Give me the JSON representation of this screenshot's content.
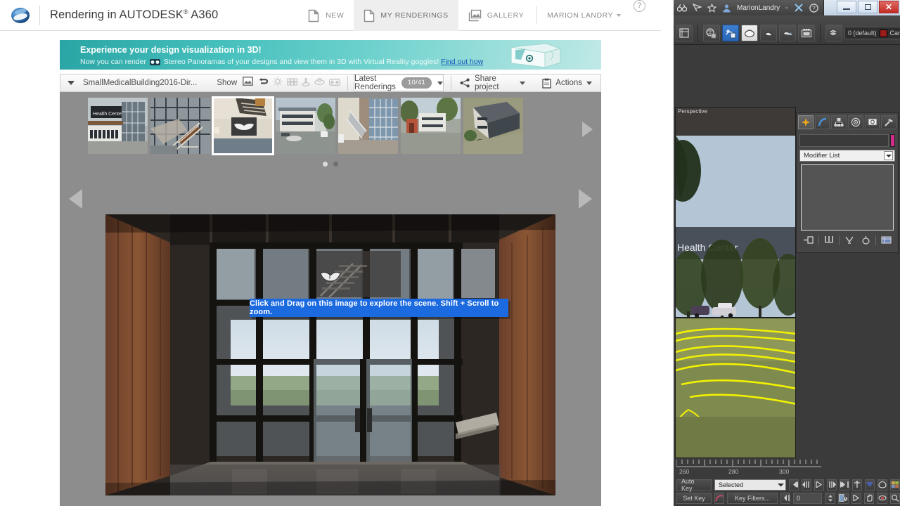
{
  "app": {
    "brand_title": "Rendering in AUTODESK",
    "brand_sup": "®",
    "brand_product": "A360",
    "logo_icon": "autodesk-a360-logo"
  },
  "nav": {
    "items": [
      {
        "label": "NEW",
        "icon": "new-document-icon",
        "active": false
      },
      {
        "label": "MY RENDERINGS",
        "icon": "document-icon",
        "active": true
      },
      {
        "label": "GALLERY",
        "icon": "gallery-image-icon",
        "active": false
      }
    ],
    "user": "MARION LANDRY",
    "user_caret_icon": "chevron-down-icon",
    "help_icon": "help-question-icon",
    "help_label": "?"
  },
  "banner": {
    "headline": "Experience your design visualization in 3D!",
    "body_before": "Now you can render",
    "goggles_icon": "vr-goggles-icon",
    "body_after": "Stereo Panoramas of your designs and view them in 3D with Virtual Reality goggles!",
    "link": "Find out how",
    "hero_icon": "vr-headset-illustration"
  },
  "toolbar": {
    "project_caret_icon": "triangle-down-icon",
    "project_name": "SmallMedicalBuilding2016-Dir...",
    "show_label": "Show",
    "filters": [
      {
        "name": "still-image-filter",
        "icon": "image-icon",
        "dim": false
      },
      {
        "name": "panorama-filter",
        "icon": "panorama-loop-icon",
        "dim": false
      },
      {
        "name": "illuminance-filter",
        "icon": "sun-icon",
        "dim": true
      },
      {
        "name": "solar-study-filter",
        "icon": "grid-study-icon",
        "dim": true
      },
      {
        "name": "turntable-filter",
        "icon": "turntable-icon",
        "dim": true
      },
      {
        "name": "interactive-filter",
        "icon": "interactive-panorama-icon",
        "dim": true
      },
      {
        "name": "stereo-panorama-filter",
        "icon": "vr-goggles-icon",
        "dim": true
      }
    ],
    "latest_label": "Latest Renderings",
    "latest_count": "10/41",
    "latest_caret_icon": "triangle-down-icon",
    "share_label": "Share project",
    "share_icon": "share-nodes-icon",
    "share_caret_icon": "triangle-down-icon",
    "actions_label": "Actions",
    "actions_icon": "clipboard-icon",
    "actions_caret_icon": "triangle-down-icon"
  },
  "filmstrip": {
    "prev_icon": "triangle-left-icon",
    "next_icon": "triangle-right-icon",
    "thumbnails": [
      {
        "name": "thumb-entry-exterior",
        "selected": false
      },
      {
        "name": "thumb-stair-glass",
        "selected": false
      },
      {
        "name": "thumb-lobby-panorama",
        "selected": true
      },
      {
        "name": "thumb-building-street",
        "selected": false
      },
      {
        "name": "thumb-atrium-stair",
        "selected": false
      },
      {
        "name": "thumb-facade-trees",
        "selected": false
      },
      {
        "name": "thumb-aerial-roof",
        "selected": false
      }
    ],
    "pages": [
      {
        "name": "page-dot-1",
        "active": true
      },
      {
        "name": "page-dot-2",
        "active": false
      }
    ]
  },
  "viewer": {
    "prev_icon": "triangle-left-icon",
    "next_icon": "triangle-right-icon",
    "hotspot_icon": "pan-360-icon",
    "tooltip": "Click and Drag on this image to explore the scene. Shift + Scroll to zoom.",
    "tooltip_color": "#1b6ae0"
  },
  "scrollbar": {
    "up_icon": "scroll-up-arrow-icon"
  },
  "max": {
    "titlebar": {
      "user": "MarionLandry",
      "icons": [
        "binoculars-icon",
        "pen-tool-icon",
        "star-favorite-icon",
        "user-avatar-icon"
      ],
      "dash": "-",
      "exchange_icon": "autodesk-exchange-icon",
      "help_icon": "help-question-icon",
      "minimize_label": "—",
      "maximize_label": "□",
      "close_label": "✕"
    },
    "toolbar": {
      "buttons": [
        "snapshot-icon",
        "material-editor-icon",
        "render-setup-icon",
        "render-frame-icon",
        "render-production-icon",
        "render-iterative-icon",
        "render-preview-icon"
      ],
      "layer_icon": "layer-manager-icon",
      "layer_name": "0 (default)",
      "layer_swatch_icon": "layer-color-swatch",
      "selection_set": "Cars"
    },
    "viewport": {
      "label": "Perspective",
      "sign_text": "Health Center"
    },
    "command_panel": {
      "tabs": [
        {
          "name": "create-tab",
          "icon": "star-create-icon",
          "active": true
        },
        {
          "name": "modify-tab",
          "icon": "modify-arc-icon",
          "active": false
        },
        {
          "name": "hierarchy-tab",
          "icon": "hierarchy-icon",
          "active": false
        },
        {
          "name": "motion-tab",
          "icon": "motion-wheel-icon",
          "active": false
        },
        {
          "name": "display-tab",
          "icon": "display-monitor-icon",
          "active": false
        },
        {
          "name": "utilities-tab",
          "icon": "hammer-utilities-icon",
          "active": false
        }
      ],
      "object_name": "",
      "object_name_placeholder": "",
      "object_color": "#d42a8c",
      "modifier_list_label": "Modifier List",
      "modifier_list_caret_icon": "chevron-down-icon",
      "stack_buttons": [
        "pin-stack-icon",
        "show-end-result-icon",
        "make-unique-icon",
        "remove-modifier-icon",
        "configure-sets-icon"
      ]
    },
    "timeline": {
      "ticks": [
        "260",
        "280",
        "300"
      ]
    },
    "status": {
      "auto_key_label": "Auto Key",
      "set_key_label": "Set Key",
      "selection_dropdown": "Selected",
      "selection_caret_icon": "chevron-down-icon",
      "key_filters_label": "Key Filters...",
      "set_key_icon": "set-key-arc-icon",
      "frame_value": "0",
      "transport": [
        "go-to-start-icon",
        "previous-frame-icon",
        "play-icon",
        "next-frame-icon",
        "go-to-end-icon"
      ],
      "tools": [
        "select-and-link-icon",
        "unlink-icon",
        "bind-to-space-warp-icon",
        "select-object-icon"
      ],
      "nav_tools": [
        "key-mode-icon",
        "time-configuration-icon",
        "play-animation-icon",
        "pan-hand-icon",
        "orbit-icon",
        "zoom-region-icon"
      ]
    }
  }
}
